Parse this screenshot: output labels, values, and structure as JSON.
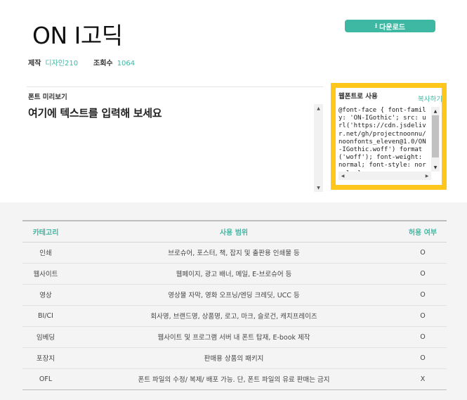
{
  "font": {
    "name": "ON I고딕",
    "download_label": "다운로드",
    "download_icon": "download-icon"
  },
  "meta": {
    "maker_label": "제작",
    "maker_value": "디자인210",
    "views_label": "조회수",
    "views_value": "1064"
  },
  "preview": {
    "label": "폰트 미리보기",
    "text": "여기에 텍스트를 입력해 보세요"
  },
  "webfont": {
    "title": "웹폰트로 사용",
    "copy_label": "복사하기",
    "code": "@font-face { font-family: 'ON-IGothic'; src: url('https://cdn.jsdelivr.net/gh/projectnoonnu/noonfonts_eleven@1.0/ON-IGothic.woff') format('woff'); font-weight: normal; font-style: normal; }"
  },
  "license": {
    "headers": [
      "카테고리",
      "사용 범위",
      "허용 여부"
    ],
    "rows": [
      {
        "category": "인쇄",
        "scope": "브로슈어, 포스터, 책, 잡지 및 출판용 인쇄물 등",
        "allowed": "O"
      },
      {
        "category": "웹사이트",
        "scope": "웹페이지, 광고 배너, 메일, E-브로슈어 등",
        "allowed": "O"
      },
      {
        "category": "영상",
        "scope": "영상물 자막, 영화 오프닝/엔딩 크레딧, UCC 등",
        "allowed": "O"
      },
      {
        "category": "BI/CI",
        "scope": "회사명, 브랜드명, 상품명, 로고, 마크, 슬로건, 캐치프레이즈",
        "allowed": "O"
      },
      {
        "category": "임베딩",
        "scope": "웹사이트 및 프로그램 서버 내 폰트 탑재, E-book 제작",
        "allowed": "O"
      },
      {
        "category": "포장지",
        "scope": "판매용 상품의 패키지",
        "allowed": "O"
      },
      {
        "category": "OFL",
        "scope": "폰트 파일의 수정/ 복제/ 배포 가능. 단, 폰트 파일의 유료 판매는 금지",
        "allowed": "X"
      }
    ]
  },
  "colors": {
    "accent": "#3fb8a3",
    "highlight_border": "#ffc61c",
    "deny": "#e53935"
  }
}
